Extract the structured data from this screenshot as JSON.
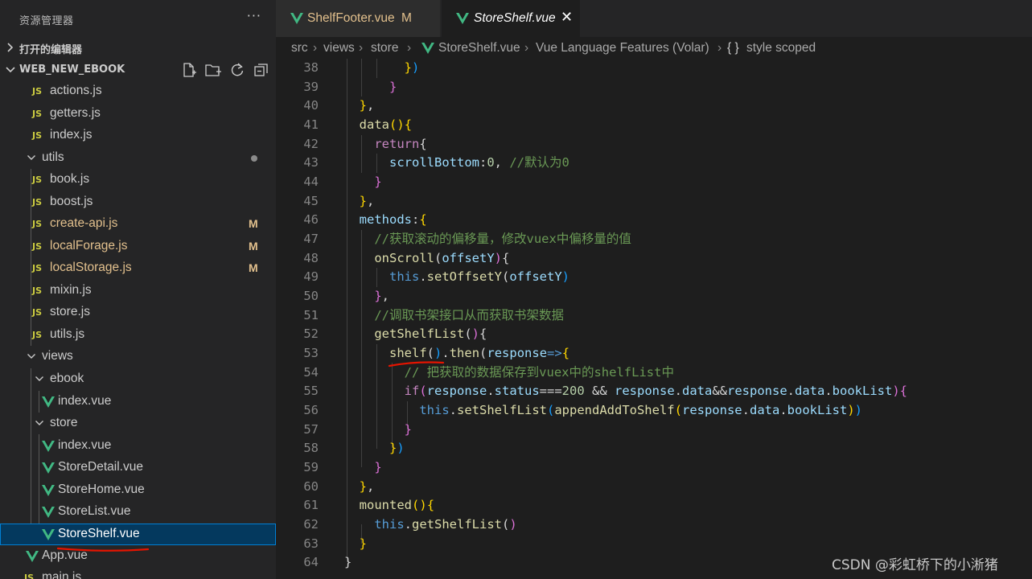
{
  "sidebar": {
    "title": "资源管理器",
    "more": "···",
    "open_editors": "打开的编辑器",
    "project": "WEB_NEW_EBOOK",
    "tree": [
      {
        "label": "actions.js",
        "type": "js"
      },
      {
        "label": "getters.js",
        "type": "js"
      },
      {
        "label": "index.js",
        "type": "js"
      },
      {
        "label": "utils",
        "type": "folder-open",
        "dot": true
      },
      {
        "label": "book.js",
        "type": "js"
      },
      {
        "label": "boost.js",
        "type": "js"
      },
      {
        "label": "create-api.js",
        "type": "js",
        "badge": "M"
      },
      {
        "label": "localForage.js",
        "type": "js",
        "badge": "M"
      },
      {
        "label": "localStorage.js",
        "type": "js",
        "badge": "M"
      },
      {
        "label": "mixin.js",
        "type": "js"
      },
      {
        "label": "store.js",
        "type": "js"
      },
      {
        "label": "utils.js",
        "type": "js"
      },
      {
        "label": "views",
        "type": "folder-open"
      },
      {
        "label": "ebook",
        "type": "folder-open"
      },
      {
        "label": "index.vue",
        "type": "vue"
      },
      {
        "label": "store",
        "type": "folder-open"
      },
      {
        "label": "index.vue",
        "type": "vue"
      },
      {
        "label": "StoreDetail.vue",
        "type": "vue"
      },
      {
        "label": "StoreHome.vue",
        "type": "vue"
      },
      {
        "label": "StoreList.vue",
        "type": "vue"
      },
      {
        "label": "StoreShelf.vue",
        "type": "vue",
        "selected": true
      },
      {
        "label": "App.vue",
        "type": "vue"
      },
      {
        "label": "main.js",
        "type": "js"
      }
    ]
  },
  "tabs": [
    {
      "label": "ShelfFooter.vue",
      "status": "M"
    },
    {
      "label": "StoreShelf.vue",
      "close": "✕"
    }
  ],
  "breadcrumb": [
    "src",
    "views",
    "store",
    "StoreShelf.vue",
    "Vue Language Features (Volar)",
    "{ }",
    "style scoped"
  ],
  "icons": {
    "js": "JS",
    "chevron-right": "›",
    "chevron-down": "⌄"
  },
  "colors": {
    "modified": "#e2c08d",
    "selected_bg": "#04395e",
    "selected_border": "#007fd4",
    "annotation": "#e51400"
  },
  "code": {
    "line_numbers": [
      "38",
      "39",
      "40",
      "41",
      "42",
      "43",
      "44",
      "45",
      "46",
      "47",
      "48",
      "49",
      "50",
      "51",
      "52",
      "53",
      "54",
      "55",
      "56",
      "57",
      "58",
      "59",
      "60",
      "61",
      "62",
      "63",
      "64"
    ],
    "lines": [
      "        })",
      "      }",
      "  },",
      "  data(){",
      "    return{",
      "      scrollBottom:0, //默认为0",
      "    }",
      "  },",
      "  methods:{",
      "    //获取滚动的偏移量，修改vuex中偏移量的值",
      "    onScroll(offsetY){",
      "      this.setOffsetY(offsetY)",
      "    },",
      "    //调取书架接口从而获取书架数据",
      "    getShelfList(){",
      "      shelf().then(response=>{",
      "        // 把获取的数据保存到vuex中的shelfList中",
      "        if(response.status===200 && response.data&&response.data.bookList){",
      "          this.setShelfList(appendAddToShelf(response.data.bookList))",
      "        }",
      "      })",
      "    }",
      "  },",
      "  mounted(){",
      "    this.getShelfList()",
      "  }",
      "}"
    ]
  },
  "watermark": "CSDN @彩虹桥下的小淅猪"
}
